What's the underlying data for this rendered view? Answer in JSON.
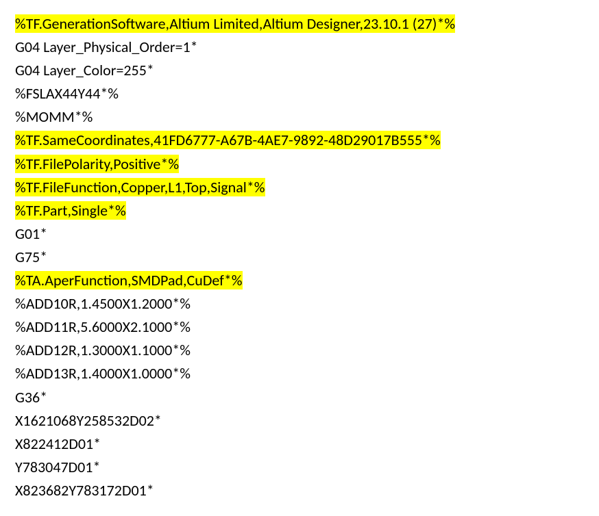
{
  "lines": [
    {
      "text": "%TF.GenerationSoftware,Altium Limited,Altium Designer,23.10.1 (27)*%",
      "highlighted": true
    },
    {
      "text": "G04 Layer_Physical_Order=1*",
      "highlighted": false
    },
    {
      "text": "G04 Layer_Color=255*",
      "highlighted": false
    },
    {
      "text": "%FSLAX44Y44*%",
      "highlighted": false
    },
    {
      "text": "%MOMM*%",
      "highlighted": false
    },
    {
      "text": "%TF.SameCoordinates,41FD6777-A67B-4AE7-9892-48D29017B555*%",
      "highlighted": true
    },
    {
      "text": "%TF.FilePolarity,Positive*%",
      "highlighted": true
    },
    {
      "text": "%TF.FileFunction,Copper,L1,Top,Signal*%",
      "highlighted": true
    },
    {
      "text": "%TF.Part,Single*%",
      "highlighted": true
    },
    {
      "text": "G01*",
      "highlighted": false
    },
    {
      "text": "G75*",
      "highlighted": false
    },
    {
      "text": "%TA.AperFunction,SMDPad,CuDef*%",
      "highlighted": true
    },
    {
      "text": "%ADD10R,1.4500X1.2000*%",
      "highlighted": false
    },
    {
      "text": "%ADD11R,5.6000X2.1000*%",
      "highlighted": false
    },
    {
      "text": "%ADD12R,1.3000X1.1000*%",
      "highlighted": false
    },
    {
      "text": "%ADD13R,1.4000X1.0000*%",
      "highlighted": false
    },
    {
      "text": "G36*",
      "highlighted": false
    },
    {
      "text": "X1621068Y258532D02*",
      "highlighted": false
    },
    {
      "text": "X822412D01*",
      "highlighted": false
    },
    {
      "text": "Y783047D01*",
      "highlighted": false
    },
    {
      "text": "X823682Y783172D01*",
      "highlighted": false
    }
  ]
}
